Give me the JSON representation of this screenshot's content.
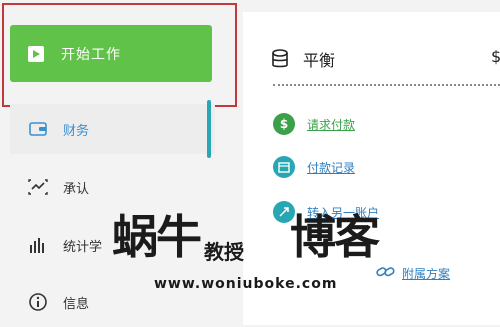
{
  "sidebar": {
    "start_label": "开始工作",
    "items": [
      {
        "label": "财务",
        "icon": "wallet-icon"
      },
      {
        "label": "承认",
        "icon": "activity-icon"
      },
      {
        "label": "统计学",
        "icon": "bar-chart-icon"
      },
      {
        "label": "信息",
        "icon": "info-icon"
      }
    ]
  },
  "panel": {
    "title": "平衡",
    "title_right": "$",
    "links": [
      {
        "label": "请求付款",
        "icon": "dollar-icon",
        "color": "#3aa14a"
      },
      {
        "label": "付款记录",
        "icon": "calendar-icon",
        "color": "#27a6b4"
      },
      {
        "label": "转入另一账户",
        "icon": "transfer-icon",
        "color": "#27a6b4"
      },
      {
        "label": "附属方案",
        "icon": "link-icon",
        "color": "#2f7fbf"
      }
    ]
  },
  "watermark": {
    "part1": "蜗牛",
    "part2": "教授",
    "part3": "博客",
    "url": "www.woniuboke.com"
  },
  "colors": {
    "start_button": "#61c24a",
    "highlight_border": "#c0393b",
    "active_bar": "#27a6b4"
  }
}
